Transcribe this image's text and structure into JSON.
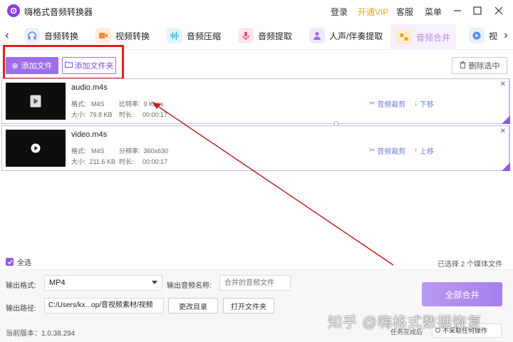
{
  "app": {
    "title": "嗨格式音频转换器",
    "header_links": [
      "登录",
      "开通VIP",
      "客服",
      "菜单"
    ]
  },
  "tabs": [
    {
      "label": "音频转换",
      "icon": "headphones-icon",
      "color": "#5a8df0"
    },
    {
      "label": "视频转换",
      "icon": "video-icon",
      "color": "#f08a3a"
    },
    {
      "label": "音频压缩",
      "icon": "waveform-icon",
      "color": "#3ab8e8"
    },
    {
      "label": "音频提取",
      "icon": "microphone-icon",
      "color": "#e84a6a"
    },
    {
      "label": "人声/伴奏提取",
      "icon": "person-icon",
      "color": "#9c6ee8"
    },
    {
      "label": "音频合并",
      "icon": "merge-icon",
      "color": "#f0a020",
      "active": true
    },
    {
      "label": "视",
      "icon": "video-convert-icon",
      "color": "#5a8df0"
    }
  ],
  "toolbar": {
    "add_file": "添加文件",
    "add_folder": "添加文件夹",
    "delete_selected": "删除选中"
  },
  "files": [
    {
      "name": "audio.m4s",
      "format_label": "格式:",
      "format": "M4S",
      "attr_label": "比特率:",
      "attr_value": "9 Kbps",
      "size_label": "大小:",
      "size": "79.8 KB",
      "duration_label": "时长:",
      "duration": "00:00:17",
      "trim": "音频裁剪",
      "move": "下移"
    },
    {
      "name": "video.m4s",
      "format_label": "格式:",
      "format": "M4S",
      "attr_label": "分辨率:",
      "attr_value": "360x630",
      "size_label": "大小:",
      "size": "211.6 KB",
      "duration_label": "时长:",
      "duration": "00:00:17",
      "trim": "音频裁剪",
      "move": "上移"
    }
  ],
  "footer": {
    "select_all": "全选",
    "selected_count": "已选择 2 个媒体文件",
    "output_format_label": "输出格式:",
    "output_format": "MP4",
    "output_name_label": "输出音频名称:",
    "output_name_placeholder": "合并的音频文件",
    "output_path_label": "输出路径:",
    "output_path": "C:/Users/kx...op/音视频素材/视频",
    "change_dir": "更改目录",
    "open_folder": "打开文件夹",
    "merge_all": "全部合并",
    "version": "当前版本：1.0.38.294",
    "task_done_label": "任务完成后",
    "task_done_option": "不采取任何操作"
  },
  "watermark": "知乎 @嗨格式数据恢复",
  "colors": {
    "accent": "#9c6ee8",
    "annotation_red": "#e02020",
    "action_blue": "#6a7fd8"
  }
}
